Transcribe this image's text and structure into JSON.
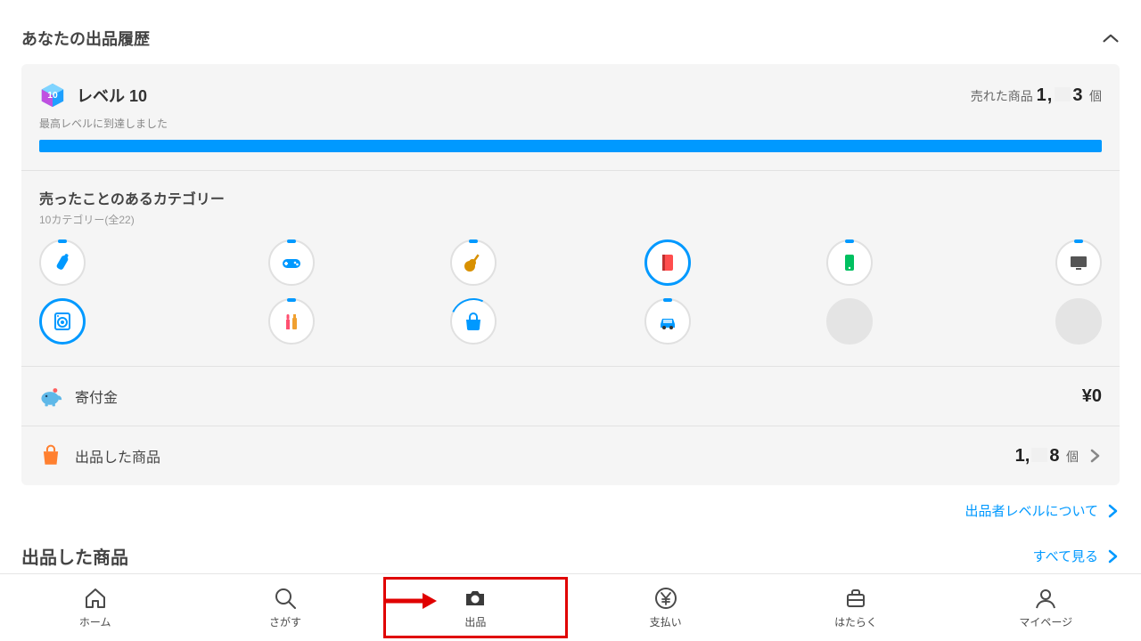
{
  "header": {
    "title": "あなたの出品履歴"
  },
  "level": {
    "title": "レベル 10",
    "sold_label": "売れた商品",
    "sold_count_prefix": "1,",
    "sold_count_suffix": "3",
    "sold_unit": "個",
    "subtitle": "最高レベルに到達しました",
    "progress_percent": 100
  },
  "categories": {
    "title": "売ったことのあるカテゴリー",
    "subtitle": "10カテゴリー(全22)",
    "items": [
      {
        "name": "baby-bottle",
        "style": "tick",
        "color": "#0099ff"
      },
      {
        "name": "game",
        "style": "tick",
        "color": "#0099ff"
      },
      {
        "name": "guitar",
        "style": "tick",
        "color": "#d89000"
      },
      {
        "name": "book",
        "style": "full",
        "color": "#ff4d4d"
      },
      {
        "name": "phone",
        "style": "tick",
        "color": "#00c060"
      },
      {
        "name": "tv",
        "style": "tick",
        "color": "#555"
      },
      {
        "name": "washer",
        "style": "full",
        "color": "#0099ff"
      },
      {
        "name": "cosmetics",
        "style": "tick",
        "color": "#f0a030"
      },
      {
        "name": "bag",
        "style": "arc",
        "color": "#0099ff"
      },
      {
        "name": "car",
        "style": "tick",
        "color": "#0099ff"
      },
      {
        "name": "empty1",
        "style": "empty",
        "color": ""
      },
      {
        "name": "empty2",
        "style": "empty",
        "color": ""
      }
    ]
  },
  "donation": {
    "label": "寄付金",
    "value": "¥0"
  },
  "listed": {
    "label": "出品した商品",
    "count_prefix": "1,",
    "count_suffix": "8",
    "unit": "個"
  },
  "link": {
    "label": "出品者レベルについて"
  },
  "section2": {
    "title": "出品した商品",
    "view_all": "すべて見る"
  },
  "nav": {
    "home": "ホーム",
    "search": "さがす",
    "sell": "出品",
    "pay": "支払い",
    "work": "はたらく",
    "mypage": "マイページ"
  }
}
